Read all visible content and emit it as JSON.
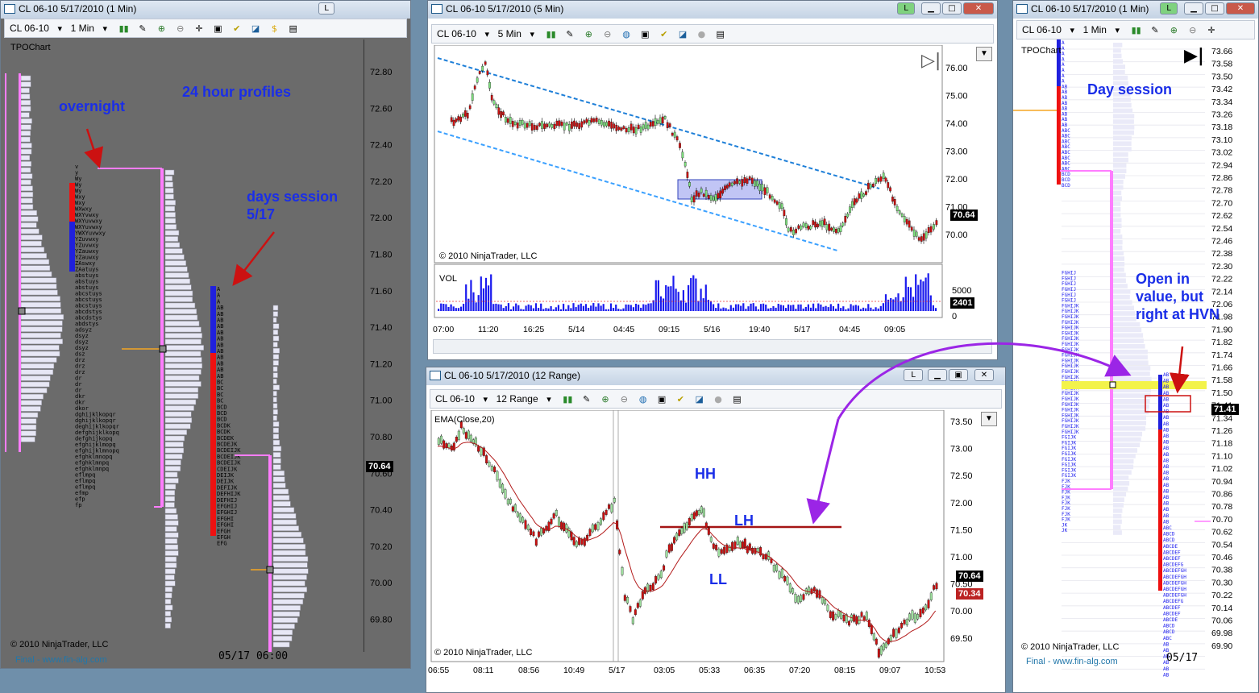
{
  "left_window": {
    "title": "CL 06-10  5/17/2010 (1 Min)",
    "toolbar": {
      "instrument": "CL 06-10",
      "interval": "1 Min"
    },
    "chart_name": "TPOChart",
    "annotations": {
      "overnight": "overnight",
      "profiles": "24 hour profiles",
      "days_session_1": "days session",
      "days_session_2": "5/17"
    },
    "price_ticks": [
      "72.80",
      "72.60",
      "72.40",
      "72.20",
      "72.00",
      "71.80",
      "71.60",
      "71.40",
      "71.20",
      "71.00",
      "70.80",
      "70.60",
      "70.40",
      "70.20",
      "70.00",
      "69.80"
    ],
    "last_price": "70.64",
    "copyright": "© 2010 NinjaTrader, LLC",
    "footer": "Final - www.fin-alg.com",
    "time_label": "05/17  06:00",
    "tpo_letters": [
      "v",
      "y",
      "Wy",
      "Wy",
      "Wy",
      "Wxy",
      "Wxy",
      "WXwxy",
      "WXYvwxy",
      "WXYuvwxy",
      "WXYuvwxy",
      "YWXYuvwxy",
      "YZuvwxy",
      "YZuvwxy",
      "YZauwxy",
      "YZauwxy",
      "ZAswxy",
      "ZAatuys",
      "abstuys",
      "abstuys",
      "abstuys",
      "abcstuys",
      "abcstuys",
      "abcstuys",
      "abcdstys",
      "abcdstys",
      "abdstys",
      "adsyz",
      "dsyz",
      "dsyz",
      "dsyz",
      "dsz",
      "drz",
      "drz",
      "drz",
      "dr",
      "dr",
      "dr",
      "dkr",
      "dkr",
      "dkor",
      "dghijklkopqr",
      "dghijklkopqr",
      "deghijklkopqr",
      "defghijklkopq",
      "defghijkopq",
      "efghijklmopq",
      "efghijklmnopq",
      "efghklmnopq",
      "efghklmnpq",
      "efghklmnpq",
      "eflmpq",
      "eflmpq",
      "eflmpq",
      "efmp",
      "efp",
      "fp"
    ],
    "session_letters": [
      "A",
      "A",
      "A",
      "AB",
      "AB",
      "AB",
      "AB",
      "AB",
      "AB",
      "AB",
      "AB",
      "AB",
      "AB",
      "AB",
      "AB",
      "BC",
      "BC",
      "BC",
      "BC",
      "BCD",
      "BCD",
      "BCD",
      "BCDK",
      "BCDK",
      "BCDEK",
      "BCDEJK",
      "BCDEIJK",
      "BCDEIJK",
      "BCDEIJK",
      "CDEIJK",
      "DEIJK",
      "DEIJK",
      "DEFIJK",
      "DEFHIJK",
      "DEFHIJ",
      "EFGHIJ",
      "EFGHIJ",
      "EFGHI",
      "EFGHI",
      "EFGH",
      "EFGH",
      "EFG"
    ]
  },
  "top_window": {
    "title": "CL 06-10  5/17/2010 (5 Min)",
    "toolbar": {
      "instrument": "CL 06-10",
      "interval": "5 Min"
    },
    "price_ticks": [
      "76.00",
      "75.00",
      "74.00",
      "73.00",
      "72.00",
      "71.00",
      "70.00"
    ],
    "last_price": "70.64",
    "copyright": "© 2010 NinjaTrader, LLC",
    "vol_label": "VOL",
    "vol_ticks": [
      "5000",
      "0"
    ],
    "vol_last": "2401",
    "time_ticks": [
      "07:00",
      "11:20",
      "16:25",
      "5/14",
      "04:45",
      "09:15",
      "5/16",
      "19:40",
      "5/17",
      "04:45",
      "09:05"
    ]
  },
  "bottom_window": {
    "title": "CL 06-10  5/17/2010 (12 Range)",
    "toolbar": {
      "instrument": "CL 06-10",
      "interval": "12 Range"
    },
    "indicator": "EMA(Close,20)",
    "price_ticks": [
      "73.50",
      "73.00",
      "72.50",
      "72.00",
      "71.50",
      "71.00",
      "70.50",
      "70.00",
      "69.50"
    ],
    "last_price": "70.64",
    "ema_price": "70.34",
    "copyright": "© 2010 NinjaTrader, LLC",
    "annotations": {
      "hh": "HH",
      "lh": "LH",
      "ll": "LL"
    },
    "time_ticks": [
      "06:55",
      "08:11",
      "08:56",
      "10:49",
      "5/17",
      "03:05",
      "05:33",
      "06:35",
      "07:20",
      "08:15",
      "09:07",
      "10:53"
    ]
  },
  "right_window": {
    "title": "CL 06-10  5/17/2010 (1 Min)",
    "toolbar": {
      "instrument": "CL 06-10",
      "interval": "1 Min"
    },
    "chart_name": "TPOChart",
    "annotations": {
      "day_session": "Day session",
      "open_1": "Open in",
      "open_2": "value, but",
      "open_3": "right at HVN"
    },
    "price_ticks": [
      "73.66",
      "73.58",
      "73.50",
      "73.42",
      "73.34",
      "73.26",
      "73.18",
      "73.10",
      "73.02",
      "72.94",
      "72.86",
      "72.78",
      "72.70",
      "72.62",
      "72.54",
      "72.46",
      "72.38",
      "72.30",
      "72.22",
      "72.14",
      "72.06",
      "71.98",
      "71.90",
      "71.82",
      "71.74",
      "71.66",
      "71.58",
      "71.50",
      "71.41",
      "71.34",
      "71.26",
      "71.18",
      "71.10",
      "71.02",
      "70.94",
      "70.86",
      "70.78",
      "70.70",
      "70.62",
      "70.54",
      "70.46",
      "70.38",
      "70.30",
      "70.22",
      "70.14",
      "70.06",
      "69.98",
      "69.90"
    ],
    "last_price": "71.41",
    "copyright": "© 2010 NinjaTrader, LLC",
    "footer": "Final - www.fin-alg.com",
    "time_label": "05/17"
  },
  "colors": {
    "profile_fill": "#e7e7f5",
    "pink": "#ff7dff",
    "blue_bar": "#2020dd",
    "red_bar": "#ee1111",
    "ann": "#1a2ee8",
    "purple_arrow": "#9b25e6"
  }
}
